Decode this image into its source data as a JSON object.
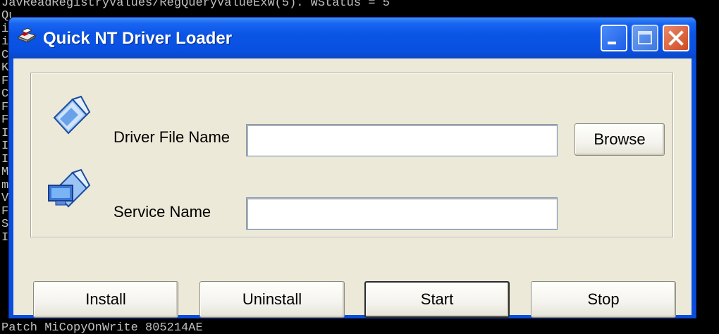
{
  "console": {
    "top_line": "JavReadRegistryValues/RegQueryValueExW(5). WStatus = 5",
    "bottom_line": "Patch MiCopyOnWrite 805214AE",
    "left_chars": [
      "Qu",
      "iv",
      "iv",
      "C",
      "K",
      "F",
      "C",
      "F",
      "F",
      "I",
      "I",
      "I",
      "M",
      "m",
      "V",
      "F",
      "S",
      "I"
    ]
  },
  "window": {
    "title": "Quick NT Driver Loader",
    "app_icon": "driver-disk-icon",
    "controls": {
      "minimize_icon": "minimize-icon",
      "maximize_icon": "maximize-icon",
      "close_icon": "close-icon"
    }
  },
  "form": {
    "driver_file": {
      "label": "Driver File Name",
      "value": "",
      "icon": "document-file-icon"
    },
    "service": {
      "label": "Service Name",
      "value": "",
      "icon": "service-computer-icon"
    },
    "browse_label": "Browse"
  },
  "actions": {
    "install_label": "Install",
    "uninstall_label": "Uninstall",
    "start_label": "Start",
    "stop_label": "Stop"
  },
  "colors": {
    "titlebar": "#0a55e6",
    "client": "#ece9d8",
    "close_button": "#d04a20"
  }
}
